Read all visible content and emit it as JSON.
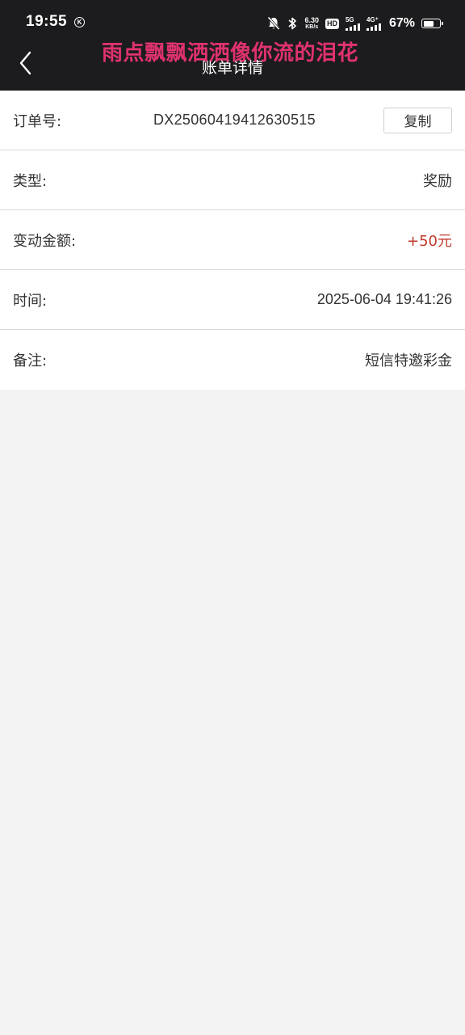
{
  "status_bar": {
    "time": "19:55",
    "k_badge": "K",
    "net_speed": "6.30",
    "net_unit": "KB/s",
    "hd_label": "HD",
    "network_5g": "5G",
    "network_4g": "4G⁺",
    "battery_percent": "67%",
    "battery_level": 0.67
  },
  "overlay_text": "雨点飘飘洒洒像你流的泪花",
  "header": {
    "title": "账单详情"
  },
  "details": {
    "order_label": "订单号:",
    "order_value": "DX25060419412630515",
    "copy_label": "复制",
    "type_label": "类型:",
    "type_value": "奖励",
    "amount_label": "变动金额:",
    "amount_value": "+50元",
    "time_label": "时间:",
    "time_value": "2025-06-04 19:41:26",
    "note_label": "备注:",
    "note_value": "短信特邀彩金"
  },
  "colors": {
    "header_bg": "#1c1c1e",
    "overlay": "#e0326e",
    "money": "#c0392b",
    "page_bg": "#f3f3f3"
  }
}
